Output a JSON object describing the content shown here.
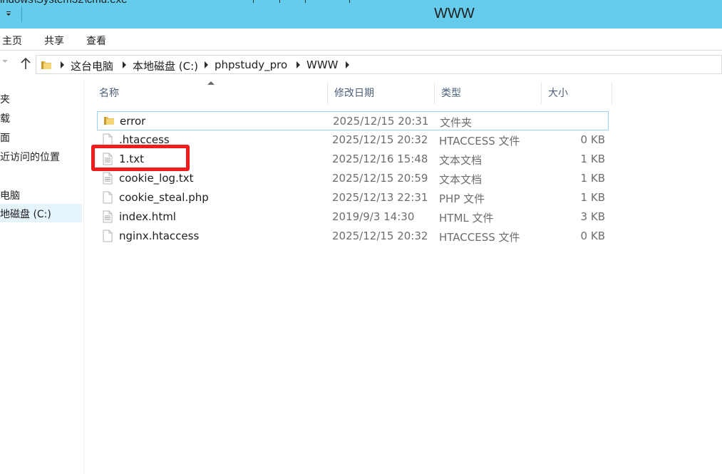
{
  "window": {
    "title": "WWW",
    "title_remnant": "indows\\System32\\cmd.exe"
  },
  "ribbon": {
    "tabs": [
      "主页",
      "共享",
      "查看"
    ]
  },
  "address": {
    "crumbs": [
      "这台电脑",
      "本地磁盘 (C:)",
      "phpstudy_pro",
      "WWW"
    ]
  },
  "navpane": {
    "items": [
      "夹",
      "载",
      "面",
      "近访问的位置",
      "电脑",
      "地磁盘 (C:)"
    ]
  },
  "columns": {
    "name": "名称",
    "date": "修改日期",
    "type": "类型",
    "size": "大小"
  },
  "files": [
    {
      "name": "error",
      "date": "2025/12/15 20:31",
      "type": "文件夹",
      "size": "",
      "icon": "folder-icon"
    },
    {
      "name": ".htaccess",
      "date": "2025/12/15 20:32",
      "type": "HTACCESS 文件",
      "size": "0 KB",
      "icon": "blank-file-icon"
    },
    {
      "name": "1.txt",
      "date": "2025/12/16 15:48",
      "type": "文本文档",
      "size": "1 KB",
      "icon": "text-file-icon"
    },
    {
      "name": "cookie_log.txt",
      "date": "2025/12/15 20:59",
      "type": "文本文档",
      "size": "1 KB",
      "icon": "text-file-icon"
    },
    {
      "name": "cookie_steal.php",
      "date": "2025/12/13 22:31",
      "type": "PHP 文件",
      "size": "1 KB",
      "icon": "blank-file-icon"
    },
    {
      "name": "index.html",
      "date": "2019/9/3 14:30",
      "type": "HTML 文件",
      "size": "3 KB",
      "icon": "text-file-icon"
    },
    {
      "name": "nginx.htaccess",
      "date": "2025/12/15 20:32",
      "type": "HTACCESS 文件",
      "size": "0 KB",
      "icon": "blank-file-icon"
    }
  ],
  "colors": {
    "titlebar": "#65ccec",
    "highlight_box": "#ee1c1c",
    "selected_nav": "#e5f3fb"
  }
}
